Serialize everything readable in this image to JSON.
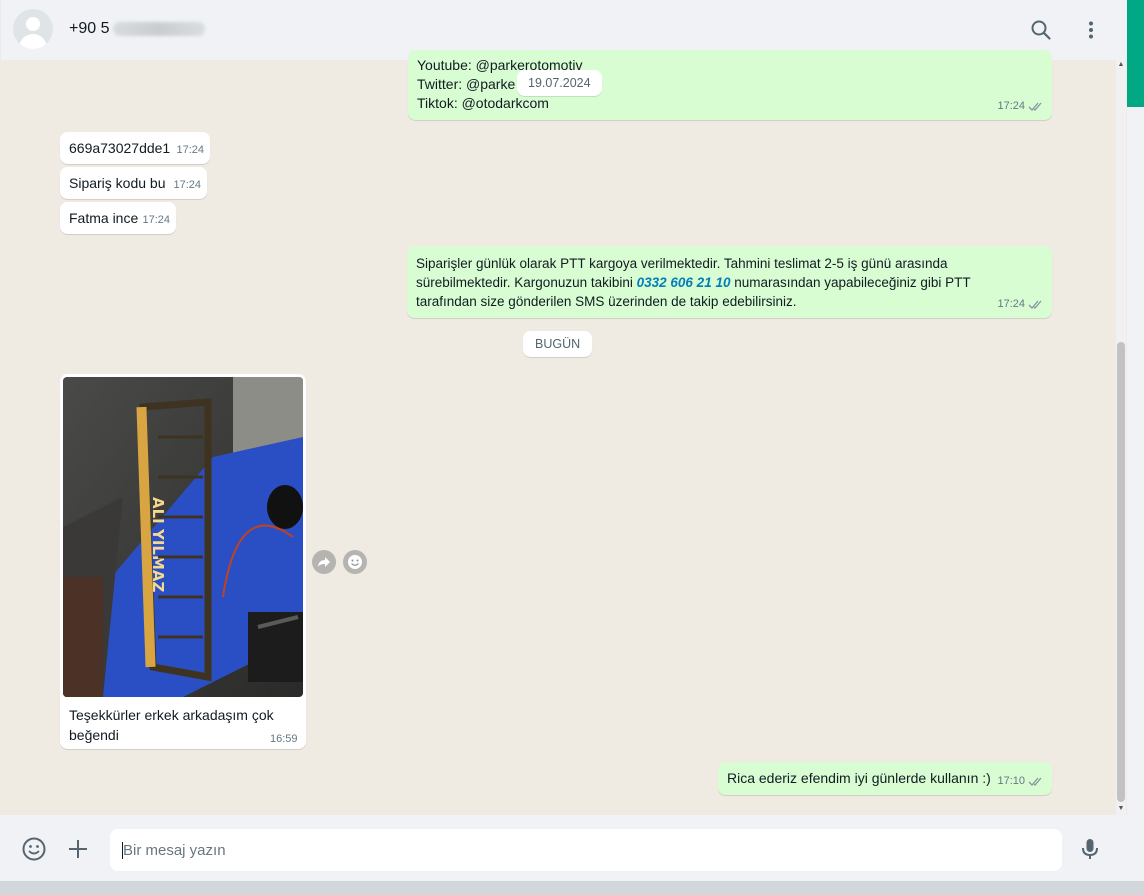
{
  "header": {
    "contact_prefix": "+90 5",
    "search_icon": "search-icon",
    "menu_icon": "kebab-menu-icon"
  },
  "messages": {
    "social": {
      "line1": "Youtube: @parkerotomotiv",
      "line2_prefix": "Twitter: @parke",
      "line3": "Tiktok: @otodarkcom",
      "time": "17:24"
    },
    "date_tooltip": "19.07.2024",
    "in1": {
      "text": "669a73027dde1",
      "time": "17:24"
    },
    "in2": {
      "text": "Sipariş kodu bu",
      "time": "17:24"
    },
    "in3": {
      "text": "Fatma ince",
      "time": "17:24"
    },
    "shipping": {
      "part1": "Siparişler günlük olarak PTT kargoya verilmektedir. Tahmini teslimat 2-5 iş günü arasında sürebilmektedir. Kargonuzun takibini ",
      "phone": "0332 606 21 10",
      "part2": " numarasından yapabileceğiniz gibi PTT tarafından size gönderilen SMS üzerinden de takip edebilirsiniz.",
      "time": "17:24"
    },
    "today_label": "BUGÜN",
    "photo": {
      "caption": "Teşekkürler erkek arkadaşım çok beğendi",
      "time": "16:59",
      "plate_text": "ALI YILMAZ"
    },
    "reply": {
      "text": "Rica ederiz efendim iyi günlerde kullanın :)",
      "time": "17:10"
    }
  },
  "footer": {
    "placeholder": "Bir mesaj yazın",
    "emoji_icon": "emoji-icon",
    "attach_icon": "plus-icon",
    "mic_icon": "microphone-icon"
  },
  "colors": {
    "outgoing_bubble": "#d9fdd3",
    "incoming_bubble": "#ffffff",
    "chat_background": "#efeae2",
    "accent": "#00a884",
    "read_ticks": "#53bdeb"
  }
}
